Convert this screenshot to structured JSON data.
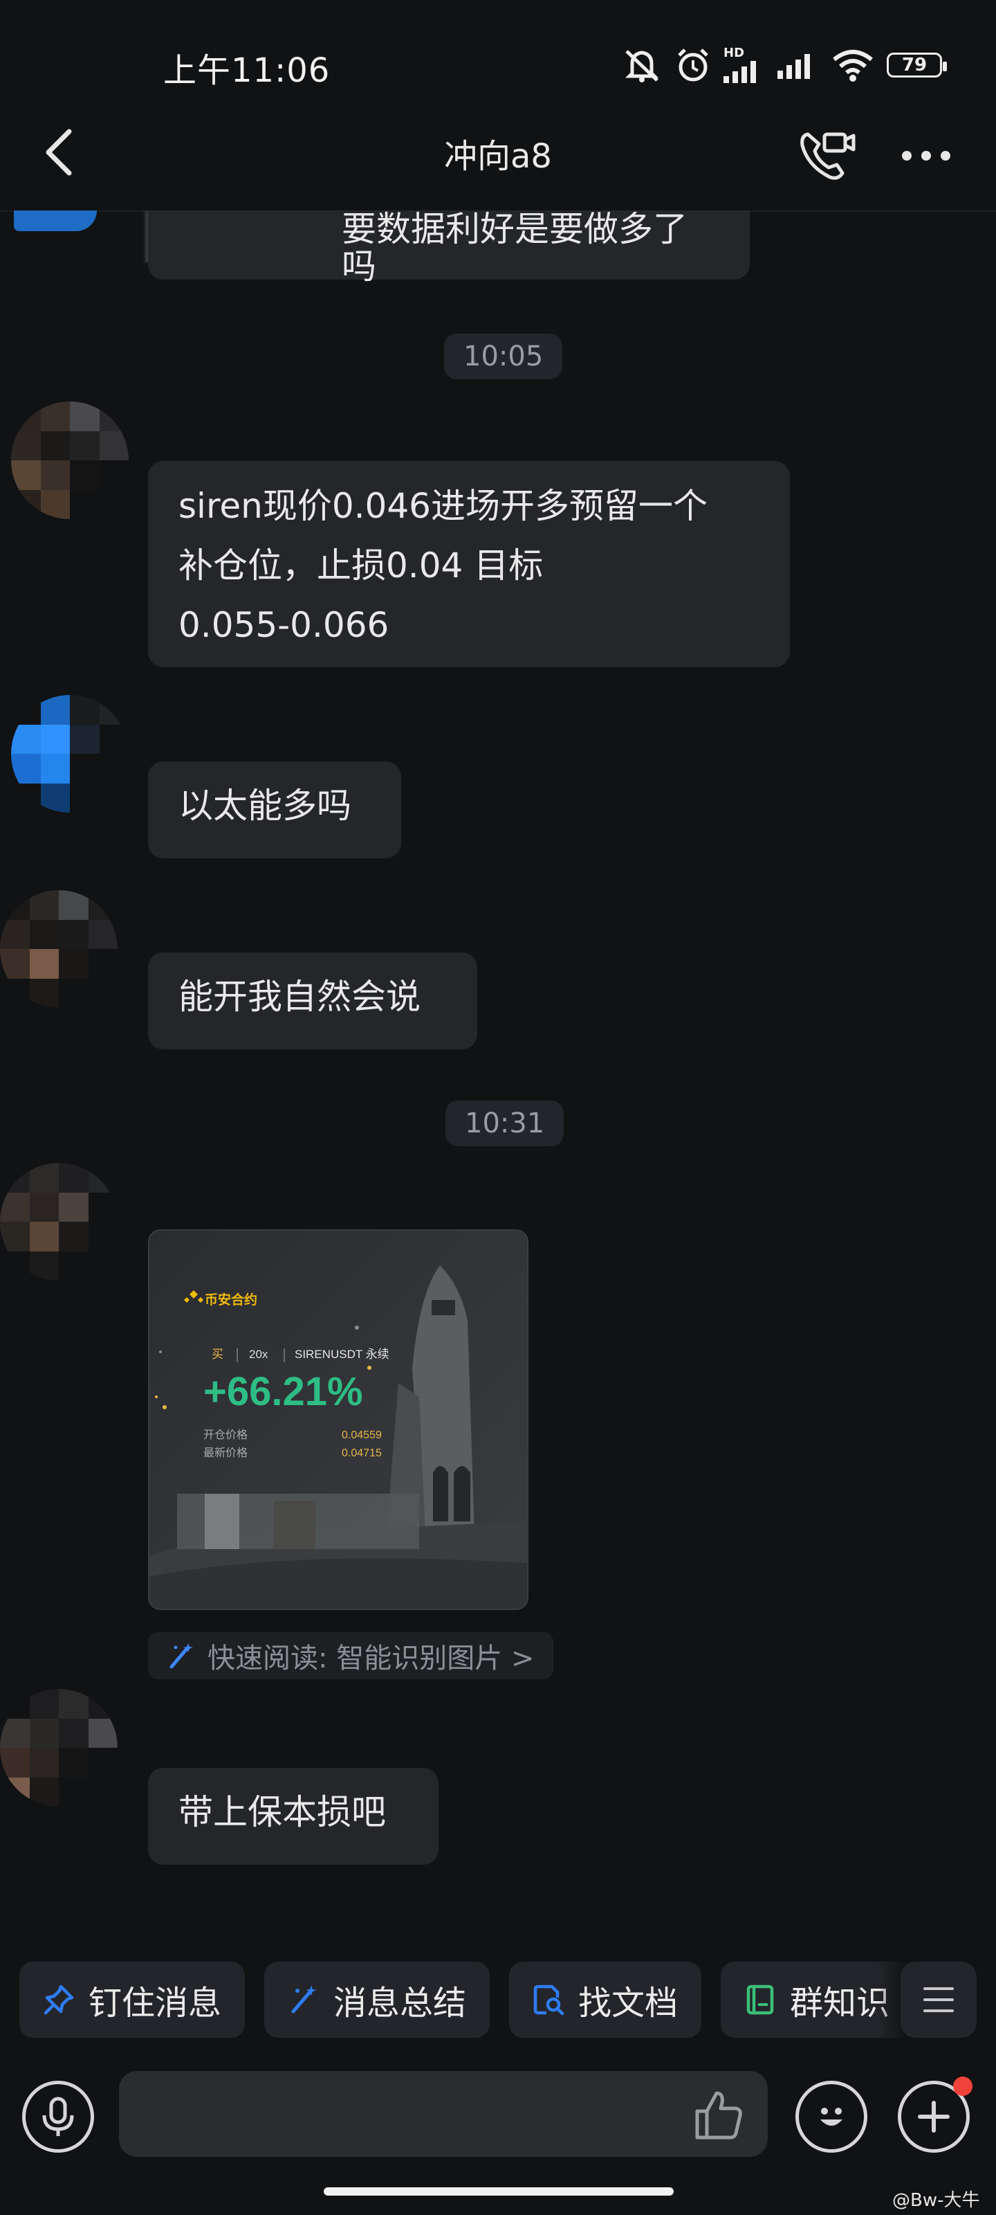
{
  "status_bar": {
    "time": "上午11:06",
    "network": "HD",
    "battery": "79"
  },
  "header": {
    "title": "冲向a8"
  },
  "messages": [
    {
      "type": "text",
      "text": "要数据利好是要做多了吗"
    },
    {
      "type": "time",
      "text": "10:05"
    },
    {
      "type": "text",
      "lines": [
        "siren现价0.046进场开多预留一个",
        "补仓位，止损0.04 目标",
        "0.055-0.066"
      ]
    },
    {
      "type": "text",
      "text": "以太能多吗"
    },
    {
      "type": "text",
      "text": "能开我自然会说"
    },
    {
      "type": "time",
      "text": "10:31"
    },
    {
      "type": "image",
      "card": {
        "brand": "币安合约",
        "side": "买",
        "leverage": "20x",
        "symbol": "SIRENUSDT 永续",
        "pnl": "+66.21%",
        "entry_label": "开仓价格",
        "entry_value": "0.04559",
        "last_label": "最新价格",
        "last_value": "0.04715"
      },
      "quick_read": "快速阅读: 智能识别图片 >"
    },
    {
      "type": "text",
      "text": "带上保本损吧"
    }
  ],
  "toolbar": {
    "chips": [
      {
        "label": "钉住消息",
        "icon": "pin-icon"
      },
      {
        "label": "消息总结",
        "icon": "magic-wand-icon"
      },
      {
        "label": "找文档",
        "icon": "doc-search-icon"
      },
      {
        "label": "群知识",
        "icon": "book-icon"
      }
    ]
  },
  "watermark": "@Bw-大牛",
  "colors": {
    "background": "#111214",
    "bubble": "#24262a",
    "accent_blue": "#2f7cf6",
    "accent_green": "#3bbf7a",
    "profit_green": "#2ebd85",
    "price_gold": "#e8b64a",
    "notification_red": "#f0433b"
  }
}
